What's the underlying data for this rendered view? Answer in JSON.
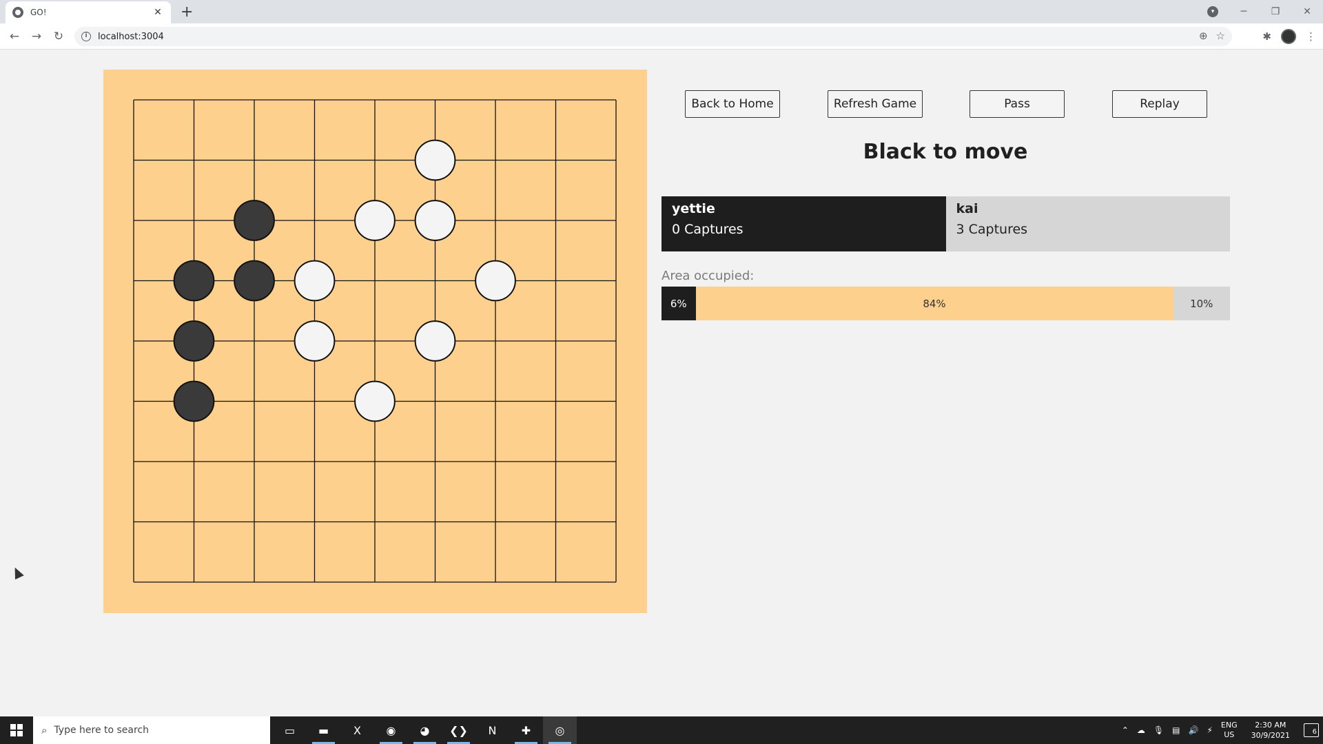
{
  "browser": {
    "tab_title": "GO!",
    "tab_close": "✕",
    "new_tab": "+",
    "url": "localhost:3004",
    "back": "←",
    "forward": "→",
    "reload": "↻",
    "info": "i",
    "zoom": "⊕",
    "bookmark": "☆",
    "extensions": "✱",
    "menu": "⋮",
    "minimize": "─",
    "restore": "❐",
    "close": "✕",
    "profile": "▾"
  },
  "controls": {
    "back_label": "Back to Home",
    "refresh_label": "Refresh Game",
    "pass_label": "Pass",
    "replay_label": "Replay"
  },
  "status": "Black to move",
  "players": {
    "black": {
      "name": "yettie",
      "captures": "0 Captures"
    },
    "white": {
      "name": "kai",
      "captures": "3 Captures"
    }
  },
  "area": {
    "label": "Area occupied:",
    "black_pct": 6,
    "empty_pct": 84,
    "white_pct": 10,
    "black_text": "6%",
    "empty_text": "84%",
    "white_text": "10%"
  },
  "board": {
    "size": 9,
    "colors": {
      "board": "#fdd08d",
      "black": "#3a3a3a",
      "white": "#f4f4f4",
      "line": "#111111"
    },
    "stones": [
      {
        "col": 5,
        "row": 1,
        "color": "white"
      },
      {
        "col": 2,
        "row": 2,
        "color": "black"
      },
      {
        "col": 4,
        "row": 2,
        "color": "white"
      },
      {
        "col": 5,
        "row": 2,
        "color": "white"
      },
      {
        "col": 1,
        "row": 3,
        "color": "black"
      },
      {
        "col": 2,
        "row": 3,
        "color": "black"
      },
      {
        "col": 3,
        "row": 3,
        "color": "white"
      },
      {
        "col": 6,
        "row": 3,
        "color": "white"
      },
      {
        "col": 1,
        "row": 4,
        "color": "black"
      },
      {
        "col": 3,
        "row": 4,
        "color": "white"
      },
      {
        "col": 5,
        "row": 4,
        "color": "white"
      },
      {
        "col": 1,
        "row": 5,
        "color": "black"
      },
      {
        "col": 4,
        "row": 5,
        "color": "white"
      }
    ]
  },
  "taskbar": {
    "search_placeholder": "Type here to search",
    "search_icon": "⌕",
    "apps": [
      {
        "name": "task-view-icon",
        "glyph": "▭",
        "open": false,
        "active": false
      },
      {
        "name": "file-explorer-icon",
        "glyph": "▬",
        "open": true,
        "active": false
      },
      {
        "name": "excel-icon",
        "glyph": "X",
        "open": false,
        "active": false
      },
      {
        "name": "chrome-icon",
        "glyph": "◉",
        "open": true,
        "active": false
      },
      {
        "name": "discord-icon",
        "glyph": "◕",
        "open": true,
        "active": false
      },
      {
        "name": "vscode-icon",
        "glyph": "❮❯",
        "open": true,
        "active": false
      },
      {
        "name": "notion-icon",
        "glyph": "N",
        "open": false,
        "active": false
      },
      {
        "name": "slack-icon",
        "glyph": "✚",
        "open": true,
        "active": false
      },
      {
        "name": "obs-icon",
        "glyph": "◎",
        "open": true,
        "active": true
      }
    ],
    "tray": {
      "chevron": "⌃",
      "cloud": "☁",
      "mic": "🎙",
      "network": "▤",
      "volume": "🔊",
      "battery": "⚡",
      "lang_top": "ENG",
      "lang_bottom": "US",
      "time": "2:30 AM",
      "date": "30/9/2021",
      "notifications": "6"
    }
  }
}
